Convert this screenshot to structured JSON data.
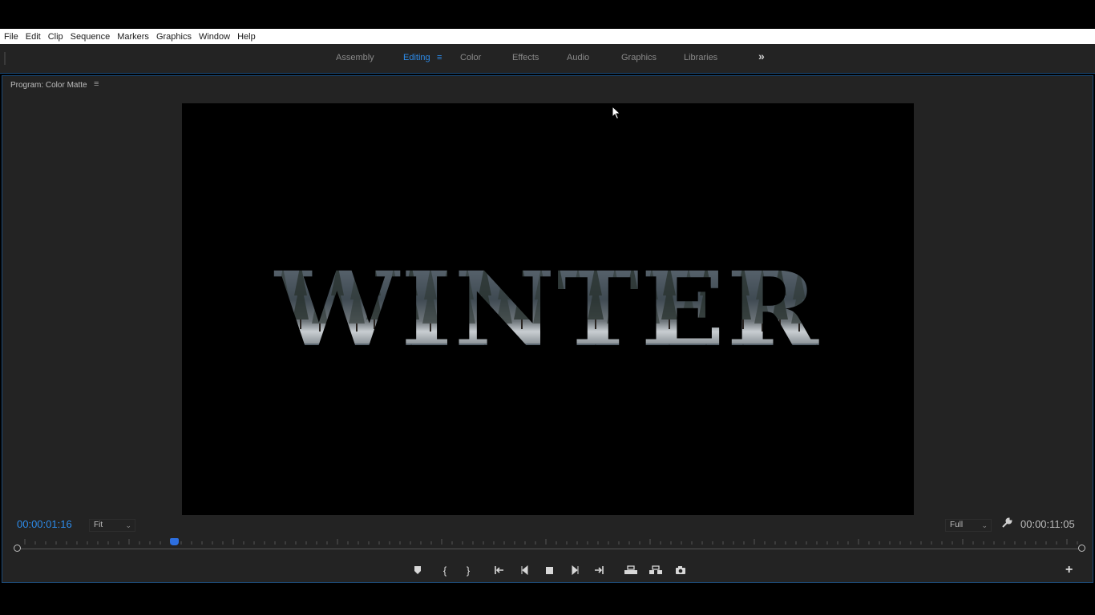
{
  "menubar": {
    "items": [
      {
        "label": "File"
      },
      {
        "label": "Edit"
      },
      {
        "label": "Clip"
      },
      {
        "label": "Sequence"
      },
      {
        "label": "Markers"
      },
      {
        "label": "Graphics"
      },
      {
        "label": "Window"
      },
      {
        "label": "Help"
      }
    ]
  },
  "workspaces": {
    "tabs": [
      {
        "label": "Assembly",
        "active": false
      },
      {
        "label": "Editing",
        "active": true
      },
      {
        "label": "Color",
        "active": false
      },
      {
        "label": "Effects",
        "active": false
      },
      {
        "label": "Audio",
        "active": false
      },
      {
        "label": "Graphics",
        "active": false
      },
      {
        "label": "Libraries",
        "active": false
      }
    ],
    "more_icon": "double-chevron-right-icon"
  },
  "monitor": {
    "title": "Program: Color Matte",
    "title_text": "WINTER",
    "current_timecode": "00:00:01:16",
    "zoom_select": "Fit",
    "resolution_select": "Full",
    "duration_timecode": "00:00:11:05",
    "playhead_fraction": 0.146
  },
  "colors": {
    "accent": "#2d8ceb",
    "panel_bg": "#232323",
    "panel_border": "#1b4a78"
  }
}
